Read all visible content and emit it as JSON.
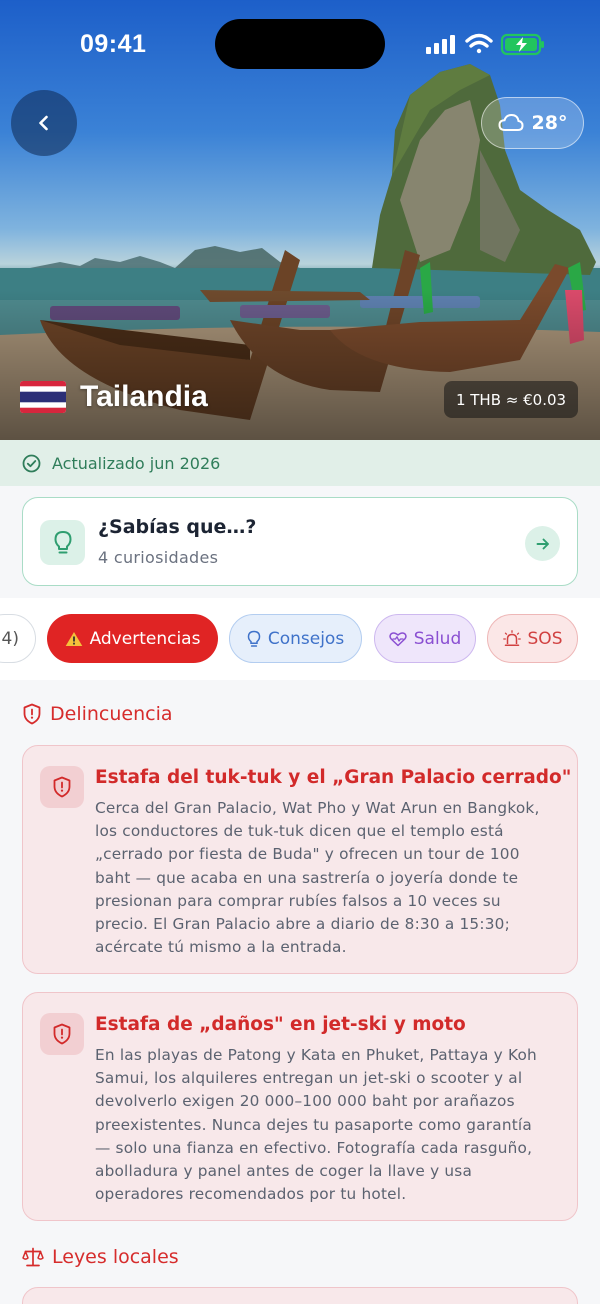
{
  "status_bar": {
    "time": "09:41"
  },
  "hero": {
    "weather": {
      "icon": "cloud-icon",
      "temperature": "28°"
    },
    "country_name": "Tailandia",
    "exchange_rate": "1 THB ≈ €0.03"
  },
  "updated": {
    "icon": "check-circle-icon",
    "text": "Actualizado jun 2026"
  },
  "facts_card": {
    "icon": "lightbulb-icon",
    "title": "¿Sabías que…?",
    "subtitle": "4 curiosidades"
  },
  "tabs": [
    {
      "label": "4)",
      "state": "partial"
    },
    {
      "label": "Advertencias",
      "icon": "warning-icon",
      "selected": true,
      "color": "#e02424"
    },
    {
      "label": "Consejos",
      "icon": "lightbulb-icon",
      "color": "#3f72c9"
    },
    {
      "label": "Salud",
      "icon": "heart-pulse-icon",
      "color": "#8a4fd2"
    },
    {
      "label": "SOS",
      "icon": "siren-icon",
      "color": "#d14141"
    }
  ],
  "sections": [
    {
      "title": "Delincuencia",
      "icon": "shield-icon",
      "items": [
        {
          "title": "Estafa del tuk-tuk y el „Gran Palacio cerrado\"",
          "body_lines": [
            "Cerca del Gran Palacio, Wat Pho y Wat Arun en Bangkok,",
            "los conductores de tuk-tuk dicen que el templo está",
            "„cerrado por fiesta de Buda\" y ofrecen un tour de 100",
            "baht — que acaba en una sastrería o joyería donde te",
            "presionan para comprar rubíes falsos a 10 veces su",
            "precio. El Gran Palacio abre a diario de 8:30 a 15:30;",
            "acércate tú mismo a la entrada."
          ]
        },
        {
          "title": "Estafa de „daños\" en jet-ski y moto",
          "body_lines": [
            "En las playas de Patong y Kata en Phuket, Pattaya y Koh",
            "Samui, los alquileres entregan un jet-ski o scooter y al",
            "devolverlo exigen 20 000–100 000 baht por arañazos",
            "preexistentes. Nunca dejes tu pasaporte como garantía",
            "— solo una fianza en efectivo. Fotografía cada rasguño,",
            "abolladura y panel antes de coger la llave y usa",
            "operadores recomendados por tu hotel."
          ]
        }
      ]
    },
    {
      "title": "Leyes locales",
      "icon": "scales-icon"
    }
  ],
  "colors": {
    "accent_green": "#2f7d5a",
    "danger_red": "#d22a2a",
    "card_red_bg": "#f8e8ea"
  }
}
